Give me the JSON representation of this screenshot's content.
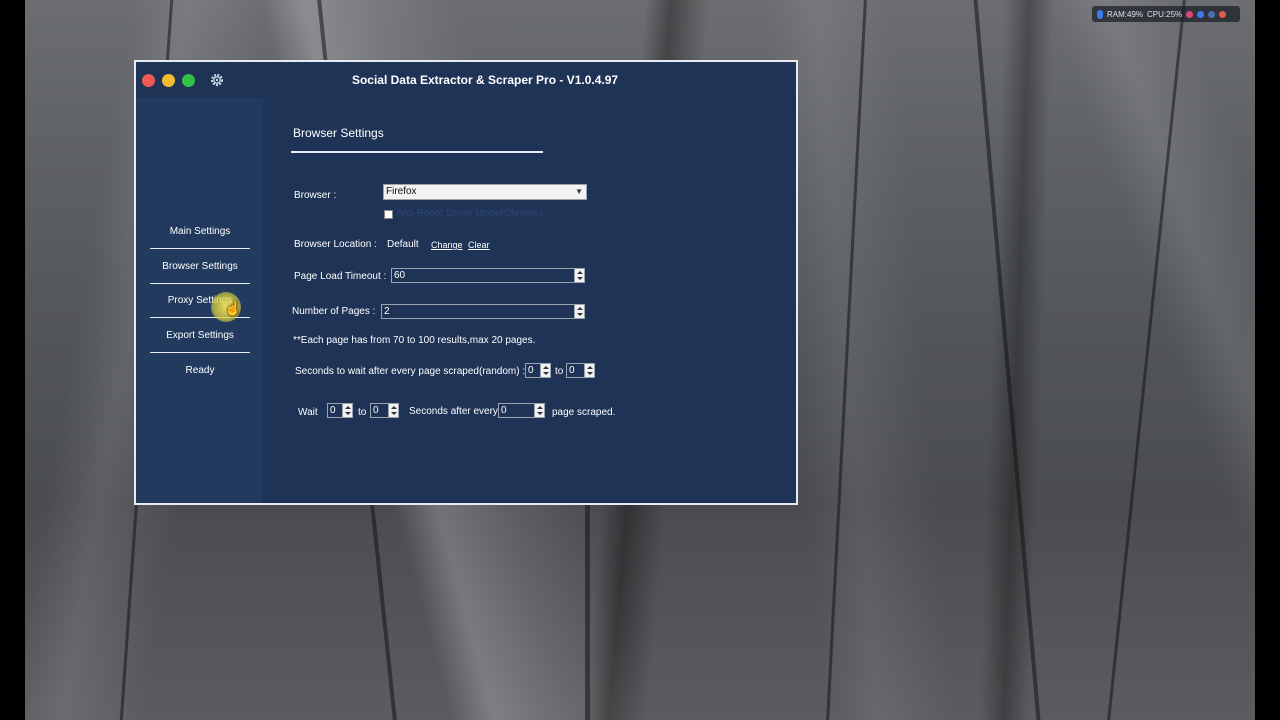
{
  "tray": {
    "ram": "RAM:49%",
    "cpu": "CPU:25%"
  },
  "window": {
    "title": "Social Data Extractor & Scraper  Pro - V1.0.4.97"
  },
  "sidebar": {
    "items": [
      {
        "label": "Main Settings"
      },
      {
        "label": "Browser Settings"
      },
      {
        "label": "Proxy Settings"
      },
      {
        "label": "Export Settings"
      },
      {
        "label": "Ready"
      }
    ]
  },
  "main": {
    "heading": "Browser Settings",
    "browser_label": "Browser :",
    "browser_value": "Firefox",
    "anti_robot_label": "Anti-Robot Driver Mode(Chrome)",
    "location_label": "Browser Location :",
    "location_value": "Default",
    "change_link": "Change",
    "clear_link": "Clear",
    "timeout_label": "Page Load Timeout :",
    "timeout_value": "60",
    "pages_label": "Number of Pages :",
    "pages_value": "2",
    "pages_note": "**Each page has from 70 to 100 results,max 20 pages.",
    "wait_random_label": "Seconds to wait after every page scraped(random) :",
    "wait_random_from": "0",
    "to_label_1": "to",
    "wait_random_to": "0",
    "wait_label": "Wait",
    "wait_from": "0",
    "to_label_2": "to",
    "wait_to": "0",
    "seconds_after_label": "Seconds after every",
    "every_value": "0",
    "page_scraped_label": "page scraped."
  }
}
